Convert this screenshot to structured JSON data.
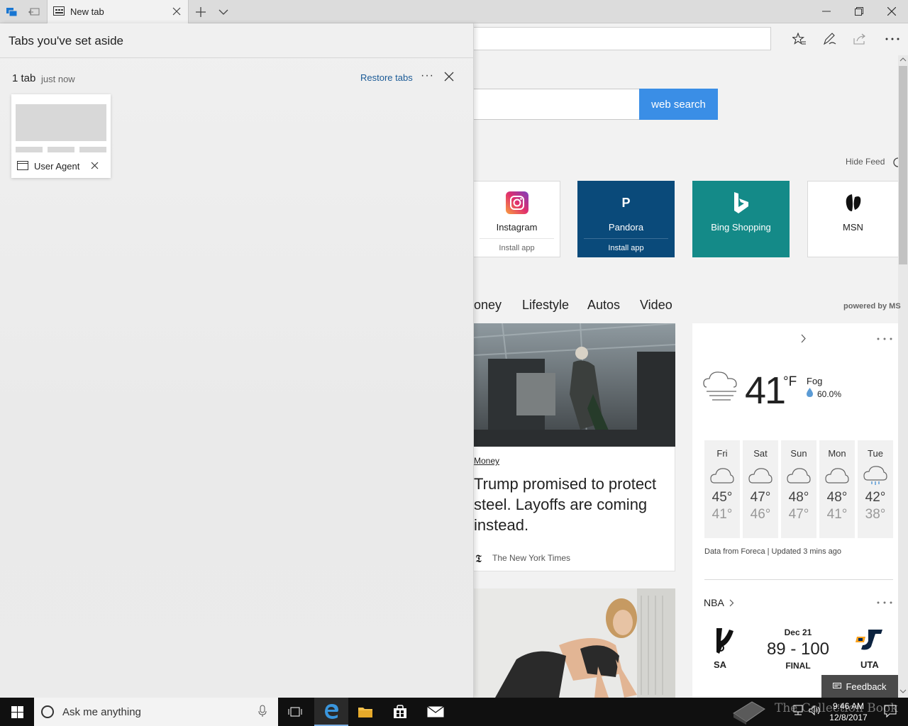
{
  "browser": {
    "tab_title": "New tab",
    "tab_icon": "newtab-page-icon",
    "new_tab_tooltip": "+",
    "window_buttons": [
      "minimize",
      "restore",
      "close"
    ],
    "toolbar_icons": [
      "favorites-star-icon",
      "web-note-pen-icon",
      "share-icon",
      "more-icon"
    ]
  },
  "aside_panel": {
    "title": "Tabs you've set aside",
    "group": {
      "count": "1 tab",
      "time": "just now",
      "restore_label": "Restore tabs",
      "more_label": "···"
    },
    "card": {
      "label": "User Agent"
    }
  },
  "new_tab_page": {
    "search_button": "web search",
    "hide_feed": "Hide Feed",
    "tiles": [
      {
        "name": "Instagram",
        "install": "Install app"
      },
      {
        "name": "Pandora",
        "install": "Install app",
        "logo": "P"
      },
      {
        "name": "Bing Shopping"
      },
      {
        "name": "MSN"
      }
    ],
    "categories": [
      "oney",
      "Lifestyle",
      "Autos",
      "Video"
    ],
    "powered_by": "powered by MS",
    "news": {
      "category": "Money",
      "title": "Trump promised to protect steel. Layoffs are coming instead.",
      "source": "The New York Times",
      "source_logo": "𝕿"
    },
    "weather": {
      "temp": "41",
      "unit": "°F",
      "condition": "Fog",
      "precip": "60.0%",
      "forecast": [
        {
          "day": "Fri",
          "hi": "45°",
          "lo": "41°"
        },
        {
          "day": "Sat",
          "hi": "47°",
          "lo": "46°"
        },
        {
          "day": "Sun",
          "hi": "48°",
          "lo": "47°"
        },
        {
          "day": "Mon",
          "hi": "48°",
          "lo": "41°"
        },
        {
          "day": "Tue",
          "hi": "42°",
          "lo": "38°"
        }
      ],
      "footer": "Data from Foreca | Updated 3 mins ago"
    },
    "nba": {
      "title": "NBA",
      "date": "Dec 21",
      "score": "89 - 100",
      "status": "FINAL",
      "home": "SA",
      "away": "UTA"
    },
    "feedback": "Feedback"
  },
  "taskbar": {
    "search_placeholder": "Ask me anything",
    "time": "9:46 AM",
    "date": "12/8/2017",
    "watermark": "The Collection Book"
  }
}
